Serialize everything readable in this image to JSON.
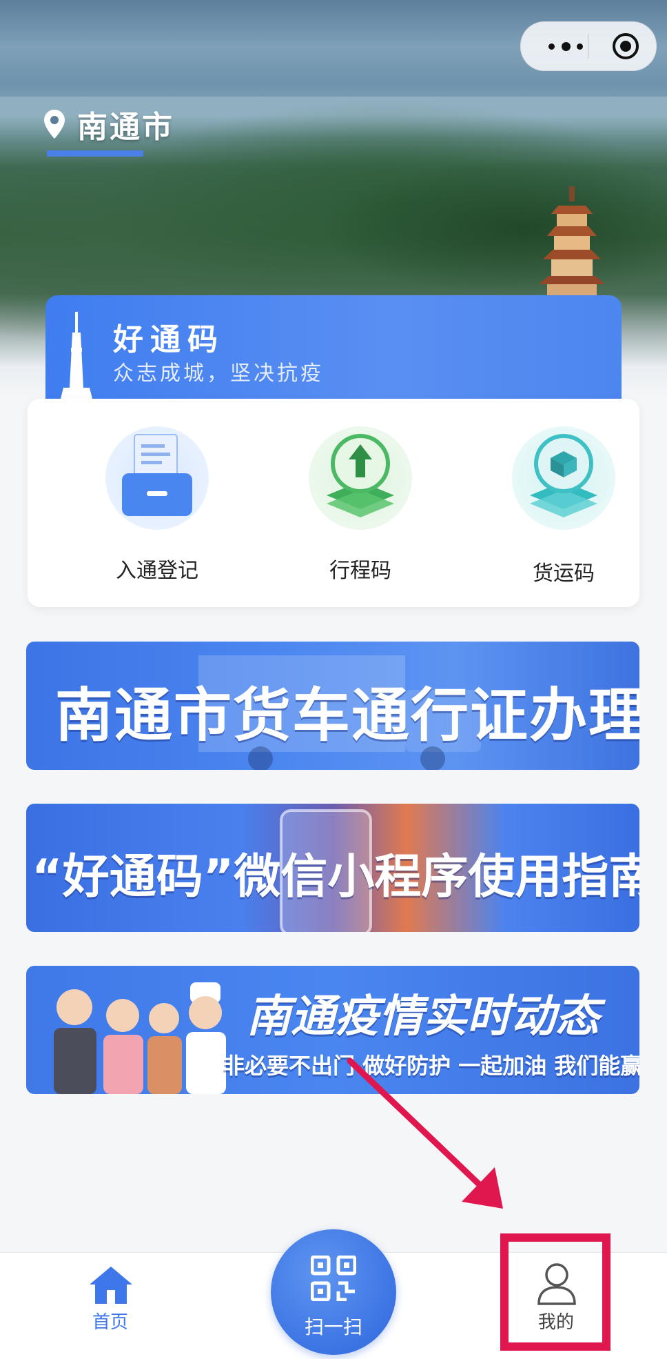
{
  "header": {
    "city": "南通市",
    "icons": [
      "location-pin-icon",
      "more-dots-icon",
      "target-circle-icon"
    ]
  },
  "brand": {
    "title": "好通码",
    "subtitle": "众志成城，坚决抗疫"
  },
  "menu": {
    "items": [
      {
        "label": "入通登记",
        "icon": "registration-tray-icon"
      },
      {
        "label": "行程码",
        "icon": "upload-arrow-icon"
      },
      {
        "label": "货运码",
        "icon": "cargo-box-icon"
      }
    ]
  },
  "banners": [
    {
      "title": "南通市货车通行证办理"
    },
    {
      "title": "“好通码”微信小程序使用指南"
    },
    {
      "title": "南通疫情实时动态",
      "subtitle": "非必要不出门 做好防护 一起加油 我们能赢"
    }
  ],
  "tabbar": {
    "home_label": "首页",
    "scan_label": "扫一扫",
    "mine_label": "我的"
  },
  "colors": {
    "accent": "#3d77ea",
    "highlight": "#e0174f",
    "tab_active": "#3d77ea",
    "tab_inactive": "#555555"
  }
}
